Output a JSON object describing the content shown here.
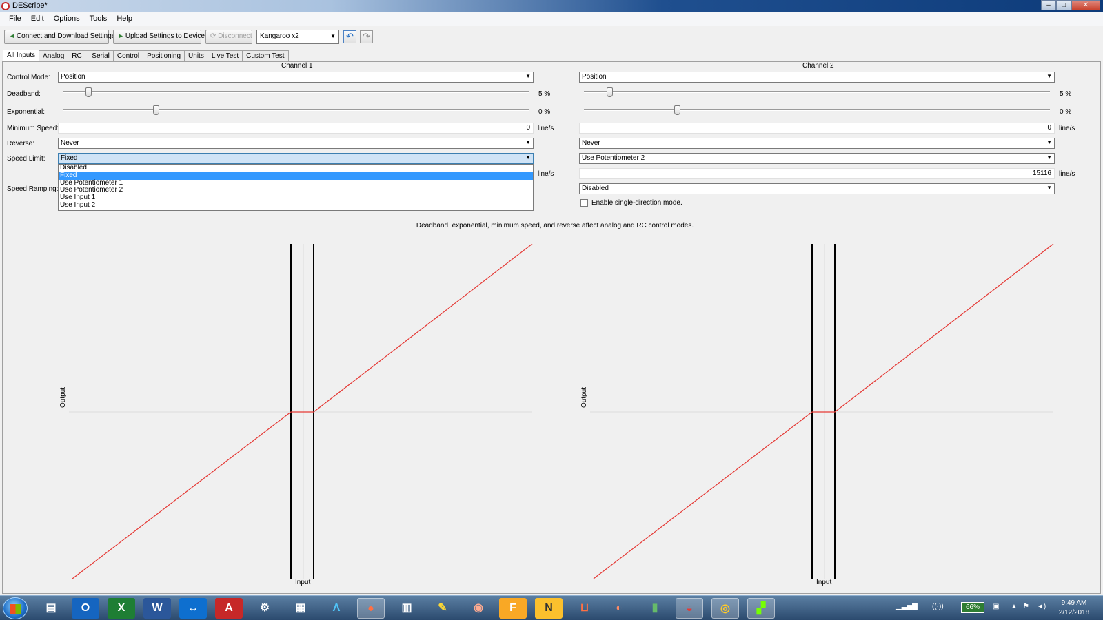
{
  "window": {
    "title": "DEScribe*",
    "minimize_glyph": "–",
    "maximize_glyph": "□",
    "close_glyph": "✕"
  },
  "menu": [
    "File",
    "Edit",
    "Options",
    "Tools",
    "Help"
  ],
  "toolbar": {
    "connect_label": "Connect and Download Settings",
    "upload_label": "Upload Settings to Device",
    "disconnect_label": "Disconnect",
    "device_select": "Kangaroo x2",
    "undo_icon": "undo-icon",
    "redo_icon": "redo-icon"
  },
  "tabs": [
    "All Inputs",
    "Analog",
    "RC",
    "Serial",
    "Control",
    "Positioning",
    "Units",
    "Live Test",
    "Custom Test"
  ],
  "labels": {
    "control_mode": "Control Mode:",
    "deadband": "Deadband:",
    "exponential": "Exponential:",
    "minimum_speed": "Minimum Speed:",
    "reverse": "Reverse:",
    "speed_limit": "Speed Limit:",
    "speed_ramping": "Speed Ramping:"
  },
  "channel1": {
    "title": "Channel 1",
    "control_mode": "Position",
    "deadband_value": "5 %",
    "deadband_level": 5,
    "exponential_value": "0 %",
    "exponential_level": 0,
    "minimum_speed": "0",
    "minimum_speed_unit": "line/s",
    "reverse": "Never",
    "speed_limit": "Fixed",
    "speed_limit_unit": "line/s"
  },
  "channel2": {
    "title": "Channel 2",
    "control_mode": "Position",
    "deadband_value": "5 %",
    "deadband_level": 5,
    "exponential_value": "0 %",
    "exponential_level": 0,
    "minimum_speed": "0",
    "minimum_speed_unit": "line/s",
    "reverse": "Never",
    "speed_limit": "Use Potentiometer 2",
    "speed_limit_value": "15116",
    "speed_limit_unit": "line/s",
    "speed_ramping": "Disabled",
    "single_direction_label": "Enable single-direction mode."
  },
  "speed_limit_dropdown": {
    "options": [
      "Disabled",
      "Fixed",
      "Use Potentiometer 1",
      "Use Potentiometer 2",
      "Use Input 1",
      "Use Input 2"
    ],
    "selected_index": 1
  },
  "note": "Deadband, exponential, minimum speed, and reverse affect analog and RC control modes.",
  "graphs": {
    "y_label": "Output",
    "x_label": "Input",
    "line_color": "#e53935",
    "deadband_line_color": "#000000"
  },
  "taskbar": {
    "apps": [
      "explorer-icon",
      "outlook-icon",
      "excel-icon",
      "word-icon",
      "teamviewer-icon",
      "acrobat-icon",
      "settings-icon",
      "calculator-icon",
      "arduino-icon",
      "firefox-icon",
      "keyboard-icon",
      "app-icon",
      "app-icon",
      "foxit-icon",
      "app-icon",
      "app-icon",
      "app-icon",
      "app-icon",
      "describe-icon",
      "chrome-icon",
      "app-icon"
    ],
    "battery": "66%",
    "time": "9:49 AM",
    "date": "2/12/2018"
  }
}
